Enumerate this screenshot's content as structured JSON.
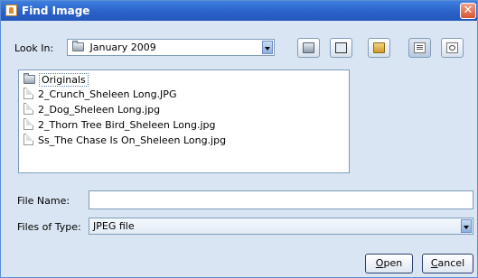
{
  "window": {
    "title": "Find Image",
    "close_glyph": "✕"
  },
  "look_in": {
    "label": "Look In:",
    "value": "January 2009"
  },
  "toolbar": {
    "buttons": [
      "up-one-level-icon",
      "home-icon",
      "new-folder-icon",
      "list-view-icon",
      "details-view-icon"
    ]
  },
  "files": [
    {
      "name": "Originals",
      "type": "folder",
      "selected": true
    },
    {
      "name": "2_Crunch_Sheleen Long.JPG",
      "type": "file"
    },
    {
      "name": "2_Dog_Sheleen Long.jpg",
      "type": "file"
    },
    {
      "name": "2_Thorn Tree Bird_Sheleen Long.jpg",
      "type": "file"
    },
    {
      "name": "Ss_The Chase Is On_Sheleen Long.jpg",
      "type": "file"
    }
  ],
  "file_name": {
    "label": "File Name:",
    "value": ""
  },
  "files_of_type": {
    "label": "Files of Type:",
    "value": "JPEG file"
  },
  "buttons": {
    "open": {
      "mnemonic": "O",
      "rest": "pen"
    },
    "cancel": {
      "mnemonic": "C",
      "rest": "ancel"
    }
  },
  "colors": {
    "title_bar": "#2a62c9",
    "dialog_bg": "#d9e5f3",
    "border": "#7f9db9"
  }
}
